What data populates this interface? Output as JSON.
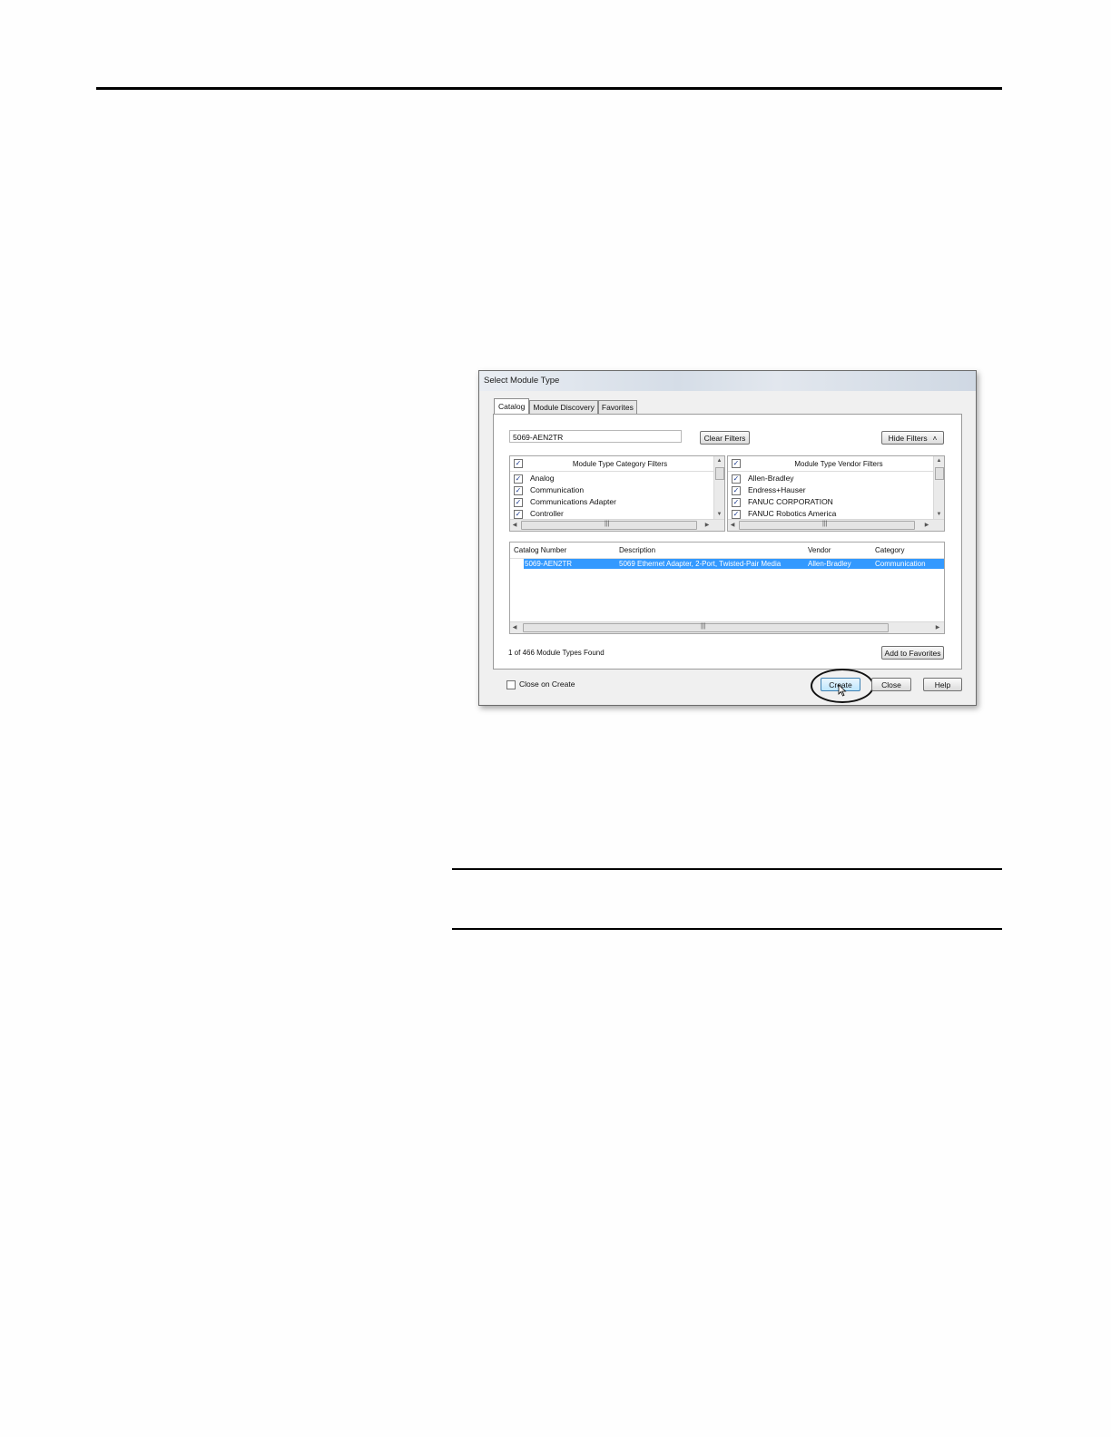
{
  "dialog": {
    "title": "Select Module Type",
    "tabs": [
      {
        "label": "Catalog",
        "active": true
      },
      {
        "label": "Module Discovery",
        "active": false
      },
      {
        "label": "Favorites",
        "active": false
      }
    ],
    "search": {
      "value": "5069-AEN2TR"
    },
    "buttons": {
      "clear_filters": "Clear Filters",
      "hide_filters": "Hide Filters",
      "add_to_favorites": "Add to Favorites",
      "create": "Create",
      "close": "Close",
      "help": "Help"
    },
    "category_filters": {
      "title": "Module Type Category Filters",
      "all_checked": true,
      "items": [
        {
          "label": "Analog",
          "checked": true
        },
        {
          "label": "Communication",
          "checked": true
        },
        {
          "label": "Communications Adapter",
          "checked": true
        },
        {
          "label": "Controller",
          "checked": true
        }
      ]
    },
    "vendor_filters": {
      "title": "Module Type Vendor Filters",
      "all_checked": true,
      "items": [
        {
          "label": "Allen-Bradley",
          "checked": true
        },
        {
          "label": "Endress+Hauser",
          "checked": true
        },
        {
          "label": "FANUC CORPORATION",
          "checked": true
        },
        {
          "label": "FANUC Robotics America",
          "checked": true
        }
      ]
    },
    "results": {
      "columns": [
        "Catalog Number",
        "Description",
        "Vendor",
        "Category"
      ],
      "rows": [
        {
          "catalog": "5069-AEN2TR",
          "description": "5069 Ethernet Adapter, 2-Port, Twisted-Pair Media",
          "vendor": "Allen-Bradley",
          "category": "Communication",
          "selected": true
        }
      ]
    },
    "status_text": "1 of 466 Module Types Found",
    "close_on_create": {
      "label": "Close on Create",
      "checked": false
    },
    "colors": {
      "selection": "#3399ff",
      "annotation_ellipse": "#111111"
    }
  }
}
